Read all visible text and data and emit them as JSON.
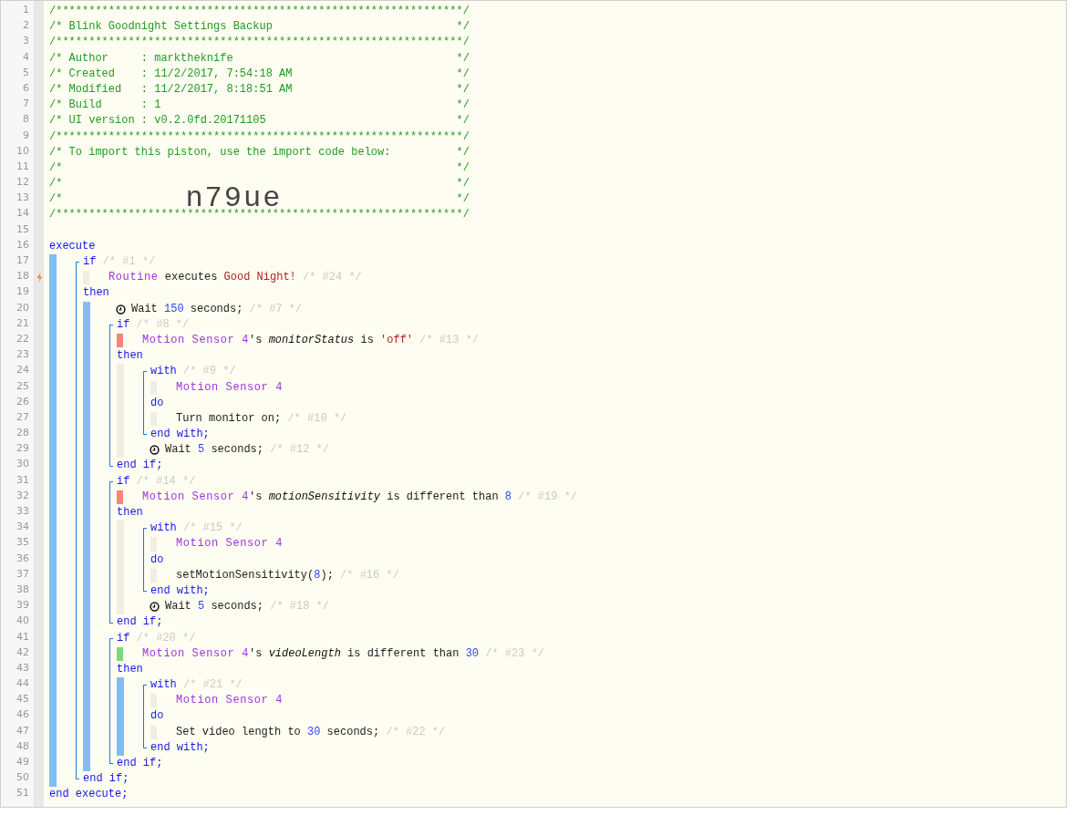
{
  "header": [
    {
      "kind": "rule",
      "text": "/**************************************************************/"
    },
    {
      "kind": "row",
      "text": "/* Blink Goodnight Settings Backup",
      "end": "*/"
    },
    {
      "kind": "rule",
      "text": "/**************************************************************/"
    },
    {
      "kind": "row",
      "text": "/* Author     : marktheknife",
      "end": "*/"
    },
    {
      "kind": "row",
      "text": "/* Created    : 11/2/2017, 7:54:18 AM",
      "end": "*/"
    },
    {
      "kind": "row",
      "text": "/* Modified   : 11/2/2017, 8:18:51 AM",
      "end": "*/"
    },
    {
      "kind": "row",
      "text": "/* Build      : 1",
      "end": "*/"
    },
    {
      "kind": "row",
      "text": "/* UI version : v0.2.0fd.20171105",
      "end": "*/"
    },
    {
      "kind": "rule",
      "text": "/**************************************************************/"
    },
    {
      "kind": "row",
      "text": "/* To import this piston, use the import code below:",
      "end": "*/"
    },
    {
      "kind": "row",
      "text": "/*",
      "end": "*/"
    },
    {
      "kind": "row",
      "text": "/*",
      "end": "*/"
    },
    {
      "kind": "import_code",
      "text": "/*",
      "code": "n79ue",
      "end": "*/"
    },
    {
      "kind": "rule",
      "text": "/**************************************************************/"
    }
  ],
  "line_numbers": [
    {
      "number": "1",
      "trigger": false
    },
    {
      "number": "2",
      "trigger": false
    },
    {
      "number": "3",
      "trigger": false
    },
    {
      "number": "4",
      "trigger": false
    },
    {
      "number": "5",
      "trigger": false
    },
    {
      "number": "6",
      "trigger": false
    },
    {
      "number": "7",
      "trigger": false
    },
    {
      "number": "8",
      "trigger": false
    },
    {
      "number": "9",
      "trigger": false
    },
    {
      "number": "10",
      "trigger": false
    },
    {
      "number": "11",
      "trigger": false
    },
    {
      "number": "12",
      "trigger": false
    },
    {
      "number": "13",
      "trigger": false
    },
    {
      "number": "14",
      "trigger": false
    },
    {
      "number": "15",
      "trigger": false
    },
    {
      "number": "16",
      "trigger": false
    },
    {
      "number": "17",
      "trigger": false
    },
    {
      "number": "18",
      "trigger": true
    },
    {
      "number": "19",
      "trigger": false
    },
    {
      "number": "20",
      "trigger": false
    },
    {
      "number": "21",
      "trigger": false
    },
    {
      "number": "22",
      "trigger": false
    },
    {
      "number": "23",
      "trigger": false
    },
    {
      "number": "24",
      "trigger": false
    },
    {
      "number": "25",
      "trigger": false
    },
    {
      "number": "26",
      "trigger": false
    },
    {
      "number": "27",
      "trigger": false
    },
    {
      "number": "28",
      "trigger": false
    },
    {
      "number": "29",
      "trigger": false
    },
    {
      "number": "30",
      "trigger": false
    },
    {
      "number": "31",
      "trigger": false
    },
    {
      "number": "32",
      "trigger": false
    },
    {
      "number": "33",
      "trigger": false
    },
    {
      "number": "34",
      "trigger": false
    },
    {
      "number": "35",
      "trigger": false
    },
    {
      "number": "36",
      "trigger": false
    },
    {
      "number": "37",
      "trigger": false
    },
    {
      "number": "38",
      "trigger": false
    },
    {
      "number": "39",
      "trigger": false
    },
    {
      "number": "40",
      "trigger": false
    },
    {
      "number": "41",
      "trigger": false
    },
    {
      "number": "42",
      "trigger": false
    },
    {
      "number": "43",
      "trigger": false
    },
    {
      "number": "44",
      "trigger": false
    },
    {
      "number": "45",
      "trigger": false
    },
    {
      "number": "46",
      "trigger": false
    },
    {
      "number": "47",
      "trigger": false
    },
    {
      "number": "48",
      "trigger": false
    },
    {
      "number": "49",
      "trigger": false
    },
    {
      "number": "50",
      "trigger": false
    },
    {
      "number": "51",
      "trigger": false
    }
  ],
  "program": {
    "open": [
      {
        "kind": "keyword",
        "text": "execute"
      }
    ],
    "body": {
      "color": "#80bdf6",
      "children": [
        {
          "kind": "if",
          "open": [
            {
              "kind": "keyword",
              "text": "if"
            },
            {
              "kind": "comment",
              "text": "/* #1 */"
            }
          ],
          "conditions": [
            {
              "color": "#efede4",
              "tokens": [
                {
                  "kind": "device",
                  "text": "Routine"
                },
                {
                  "kind": "plain",
                  "text": "executes"
                },
                {
                  "kind": "string",
                  "text": "Good Night!"
                },
                {
                  "kind": "comment",
                  "text": "/* #24 */"
                }
              ]
            }
          ],
          "then_label": [
            {
              "kind": "keyword",
              "text": "then"
            }
          ],
          "then": {
            "color": "#80bdf6",
            "children": [
              {
                "kind": "wait",
                "tokens": [
                  {
                    "kind": "plain",
                    "text": "Wait"
                  },
                  {
                    "kind": "number",
                    "text": "150"
                  },
                  {
                    "kind": "plain",
                    "text": "seconds;"
                  },
                  {
                    "kind": "comment",
                    "text": "/* #7 */"
                  }
                ]
              },
              {
                "kind": "if",
                "open": [
                  {
                    "kind": "keyword",
                    "text": "if"
                  },
                  {
                    "kind": "comment",
                    "text": "/* #8 */"
                  }
                ],
                "conditions": [
                  {
                    "color": "#f7857a",
                    "tokens": [
                      {
                        "kind": "device",
                        "text": "Motion Sensor 4"
                      },
                      {
                        "kind": "glued",
                        "text": "'s"
                      },
                      {
                        "kind": "attribute",
                        "text": "monitorStatus"
                      },
                      {
                        "kind": "plain",
                        "text": "is"
                      },
                      {
                        "kind": "string",
                        "text": "'off'"
                      },
                      {
                        "kind": "comment",
                        "text": "/* #13 */"
                      }
                    ]
                  }
                ],
                "then_label": [
                  {
                    "kind": "keyword",
                    "text": "then"
                  }
                ],
                "then": {
                  "color": "#efede4",
                  "children": [
                    {
                      "kind": "with",
                      "open": [
                        {
                          "kind": "keyword",
                          "text": "with"
                        },
                        {
                          "kind": "comment",
                          "text": "/* #9 */"
                        }
                      ],
                      "devices": [
                        {
                          "color": "#efede4",
                          "tokens": [
                            {
                              "kind": "device",
                              "text": "Motion Sensor 4"
                            }
                          ]
                        }
                      ],
                      "do_label": [
                        {
                          "kind": "keyword",
                          "text": "do"
                        }
                      ],
                      "tasks": [
                        {
                          "color": "#efede4",
                          "tokens": [
                            {
                              "kind": "plain",
                              "text": "Turn monitor on;"
                            },
                            {
                              "kind": "comment",
                              "text": "/* #10 */"
                            }
                          ]
                        }
                      ],
                      "close": [
                        {
                          "kind": "keyword",
                          "text": "end with;"
                        }
                      ]
                    },
                    {
                      "kind": "wait",
                      "tokens": [
                        {
                          "kind": "plain",
                          "text": "Wait"
                        },
                        {
                          "kind": "number",
                          "text": "5"
                        },
                        {
                          "kind": "plain",
                          "text": "seconds;"
                        },
                        {
                          "kind": "comment",
                          "text": "/* #12 */"
                        }
                      ]
                    }
                  ]
                },
                "close": [
                  {
                    "kind": "keyword",
                    "text": "end if;"
                  }
                ]
              },
              {
                "kind": "if",
                "open": [
                  {
                    "kind": "keyword",
                    "text": "if"
                  },
                  {
                    "kind": "comment",
                    "text": "/* #14 */"
                  }
                ],
                "conditions": [
                  {
                    "color": "#f7857a",
                    "tokens": [
                      {
                        "kind": "device",
                        "text": "Motion Sensor 4"
                      },
                      {
                        "kind": "glued",
                        "text": "'s"
                      },
                      {
                        "kind": "attribute",
                        "text": "motionSensitivity"
                      },
                      {
                        "kind": "plain",
                        "text": "is different than"
                      },
                      {
                        "kind": "number",
                        "text": "8"
                      },
                      {
                        "kind": "comment",
                        "text": "/* #19 */"
                      }
                    ]
                  }
                ],
                "then_label": [
                  {
                    "kind": "keyword",
                    "text": "then"
                  }
                ],
                "then": {
                  "color": "#efede4",
                  "children": [
                    {
                      "kind": "with",
                      "open": [
                        {
                          "kind": "keyword",
                          "text": "with"
                        },
                        {
                          "kind": "comment",
                          "text": "/* #15 */"
                        }
                      ],
                      "devices": [
                        {
                          "color": "#efede4",
                          "tokens": [
                            {
                              "kind": "device",
                              "text": "Motion Sensor 4"
                            }
                          ]
                        }
                      ],
                      "do_label": [
                        {
                          "kind": "keyword",
                          "text": "do"
                        }
                      ],
                      "tasks": [
                        {
                          "color": "#efede4",
                          "tokens": [
                            {
                              "kind": "plain",
                              "text": "setMotionSensitivity("
                            },
                            {
                              "kind": "glued_number",
                              "text": "8"
                            },
                            {
                              "kind": "glued",
                              "text": ");"
                            },
                            {
                              "kind": "comment",
                              "text": "/* #16 */"
                            }
                          ]
                        }
                      ],
                      "close": [
                        {
                          "kind": "keyword",
                          "text": "end with;"
                        }
                      ]
                    },
                    {
                      "kind": "wait",
                      "tokens": [
                        {
                          "kind": "plain",
                          "text": "Wait"
                        },
                        {
                          "kind": "number",
                          "text": "5"
                        },
                        {
                          "kind": "plain",
                          "text": "seconds;"
                        },
                        {
                          "kind": "comment",
                          "text": "/* #18 */"
                        }
                      ]
                    }
                  ]
                },
                "close": [
                  {
                    "kind": "keyword",
                    "text": "end if;"
                  }
                ]
              },
              {
                "kind": "if",
                "open": [
                  {
                    "kind": "keyword",
                    "text": "if"
                  },
                  {
                    "kind": "comment",
                    "text": "/* #20 */"
                  }
                ],
                "conditions": [
                  {
                    "color": "#7dd87b",
                    "tokens": [
                      {
                        "kind": "device",
                        "text": "Motion Sensor 4"
                      },
                      {
                        "kind": "glued",
                        "text": "'s"
                      },
                      {
                        "kind": "attribute",
                        "text": "videoLength"
                      },
                      {
                        "kind": "plain",
                        "text": "is different than"
                      },
                      {
                        "kind": "number",
                        "text": "30"
                      },
                      {
                        "kind": "comment",
                        "text": "/* #23 */"
                      }
                    ]
                  }
                ],
                "then_label": [
                  {
                    "kind": "keyword",
                    "text": "then"
                  }
                ],
                "then": {
                  "color": "#80bdf6",
                  "children": [
                    {
                      "kind": "with",
                      "open": [
                        {
                          "kind": "keyword",
                          "text": "with"
                        },
                        {
                          "kind": "comment",
                          "text": "/* #21 */"
                        }
                      ],
                      "devices": [
                        {
                          "color": "#efede4",
                          "tokens": [
                            {
                              "kind": "device",
                              "text": "Motion Sensor 4"
                            }
                          ]
                        }
                      ],
                      "do_label": [
                        {
                          "kind": "keyword",
                          "text": "do"
                        }
                      ],
                      "tasks": [
                        {
                          "color": "#efede4",
                          "tokens": [
                            {
                              "kind": "plain",
                              "text": "Set video length to"
                            },
                            {
                              "kind": "number",
                              "text": "30"
                            },
                            {
                              "kind": "plain",
                              "text": "seconds;"
                            },
                            {
                              "kind": "comment",
                              "text": "/* #22 */"
                            }
                          ]
                        }
                      ],
                      "close": [
                        {
                          "kind": "keyword",
                          "text": "end with;"
                        }
                      ]
                    }
                  ]
                },
                "close": [
                  {
                    "kind": "keyword",
                    "text": "end if;"
                  }
                ]
              }
            ]
          },
          "close": [
            {
              "kind": "keyword",
              "text": "end if;"
            }
          ]
        }
      ]
    },
    "close": [
      {
        "kind": "keyword",
        "text": "end execute;"
      }
    ]
  }
}
